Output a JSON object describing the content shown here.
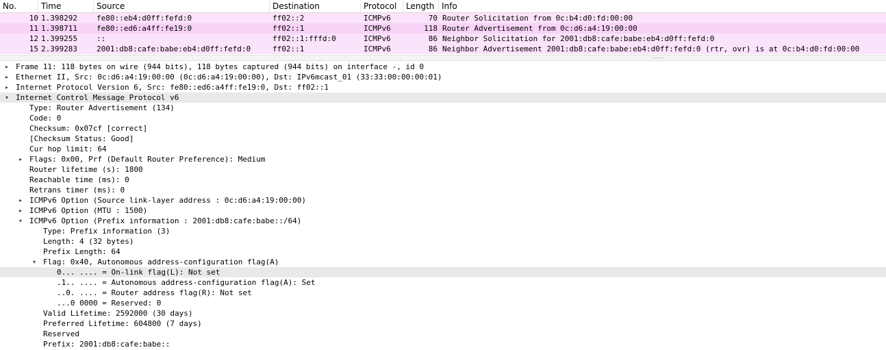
{
  "packet_list": {
    "columns": [
      "No.",
      "Time",
      "Source",
      "Destination",
      "Protocol",
      "Length",
      "Info"
    ],
    "rows": [
      {
        "no": "10",
        "time": "1.398292",
        "source": "fe80::eb4:d0ff:fefd:0",
        "destination": "ff02::2",
        "protocol": "ICMPv6",
        "length": "70",
        "info": "Router Solicitation from 0c:b4:d0:fd:00:00"
      },
      {
        "no": "11",
        "time": "1.398711",
        "source": "fe80::ed6:a4ff:fe19:0",
        "destination": "ff02::1",
        "protocol": "ICMPv6",
        "length": "118",
        "info": "Router Advertisement from 0c:d6:a4:19:00:00"
      },
      {
        "no": "12",
        "time": "1.399255",
        "source": "::",
        "destination": "ff02::1:fffd:0",
        "protocol": "ICMPv6",
        "length": "86",
        "info": "Neighbor Solicitation for 2001:db8:cafe:babe:eb4:d0ff:fefd:0"
      },
      {
        "no": "15",
        "time": "2.399283",
        "source": "2001:db8:cafe:babe:eb4:d0ff:fefd:0",
        "destination": "ff02::1",
        "protocol": "ICMPv6",
        "length": "86",
        "info": "Neighbor Advertisement 2001:db8:cafe:babe:eb4:d0ff:fefd:0 (rtr, ovr) is at 0c:b4:d0:fd:00:00"
      }
    ]
  },
  "detail_tree": [
    {
      "text": "Frame 11: 118 bytes on wire (944 bits), 118 bytes captured (944 bits) on interface -, id 0",
      "toggle": "collapsed"
    },
    {
      "text": "Ethernet II, Src: 0c:d6:a4:19:00:00 (0c:d6:a4:19:00:00), Dst: IPv6mcast_01 (33:33:00:00:00:01)",
      "toggle": "collapsed"
    },
    {
      "text": "Internet Protocol Version 6, Src: fe80::ed6:a4ff:fe19:0, Dst: ff02::1",
      "toggle": "collapsed"
    },
    {
      "text": "Internet Control Message Protocol v6",
      "toggle": "expanded"
    },
    {
      "text": "Type: Router Advertisement (134)",
      "toggle": "none"
    },
    {
      "text": "Code: 0",
      "toggle": "none"
    },
    {
      "text": "Checksum: 0x07cf [correct]",
      "toggle": "none"
    },
    {
      "text": "[Checksum Status: Good]",
      "toggle": "none"
    },
    {
      "text": "Cur hop limit: 64",
      "toggle": "none"
    },
    {
      "text": "Flags: 0x00, Prf (Default Router Preference): Medium",
      "toggle": "collapsed"
    },
    {
      "text": "Router lifetime (s): 1800",
      "toggle": "none"
    },
    {
      "text": "Reachable time (ms): 0",
      "toggle": "none"
    },
    {
      "text": "Retrans timer (ms): 0",
      "toggle": "none"
    },
    {
      "text": "ICMPv6 Option (Source link-layer address : 0c:d6:a4:19:00:00)",
      "toggle": "collapsed"
    },
    {
      "text": "ICMPv6 Option (MTU : 1500)",
      "toggle": "collapsed"
    },
    {
      "text": "ICMPv6 Option (Prefix information : 2001:db8:cafe:babe::/64)",
      "toggle": "expanded"
    },
    {
      "text": "Type: Prefix information (3)",
      "toggle": "none"
    },
    {
      "text": "Length: 4 (32 bytes)",
      "toggle": "none"
    },
    {
      "text": "Prefix Length: 64",
      "toggle": "none"
    },
    {
      "text": "Flag: 0x40, Autonomous address-configuration flag(A)",
      "toggle": "expanded"
    },
    {
      "text": "0... .... = On-link flag(L): Not set",
      "toggle": "none"
    },
    {
      "text": ".1.. .... = Autonomous address-configuration flag(A): Set",
      "toggle": "none"
    },
    {
      "text": "..0. .... = Router address flag(R): Not set",
      "toggle": "none"
    },
    {
      "text": "...0 0000 = Reserved: 0",
      "toggle": "none"
    },
    {
      "text": "Valid Lifetime: 2592000 (30 days)",
      "toggle": "none"
    },
    {
      "text": "Preferred Lifetime: 604800 (7 days)",
      "toggle": "none"
    },
    {
      "text": "Reserved",
      "toggle": "none"
    },
    {
      "text": "Prefix: 2001:db8:cafe:babe::",
      "toggle": "none"
    }
  ]
}
